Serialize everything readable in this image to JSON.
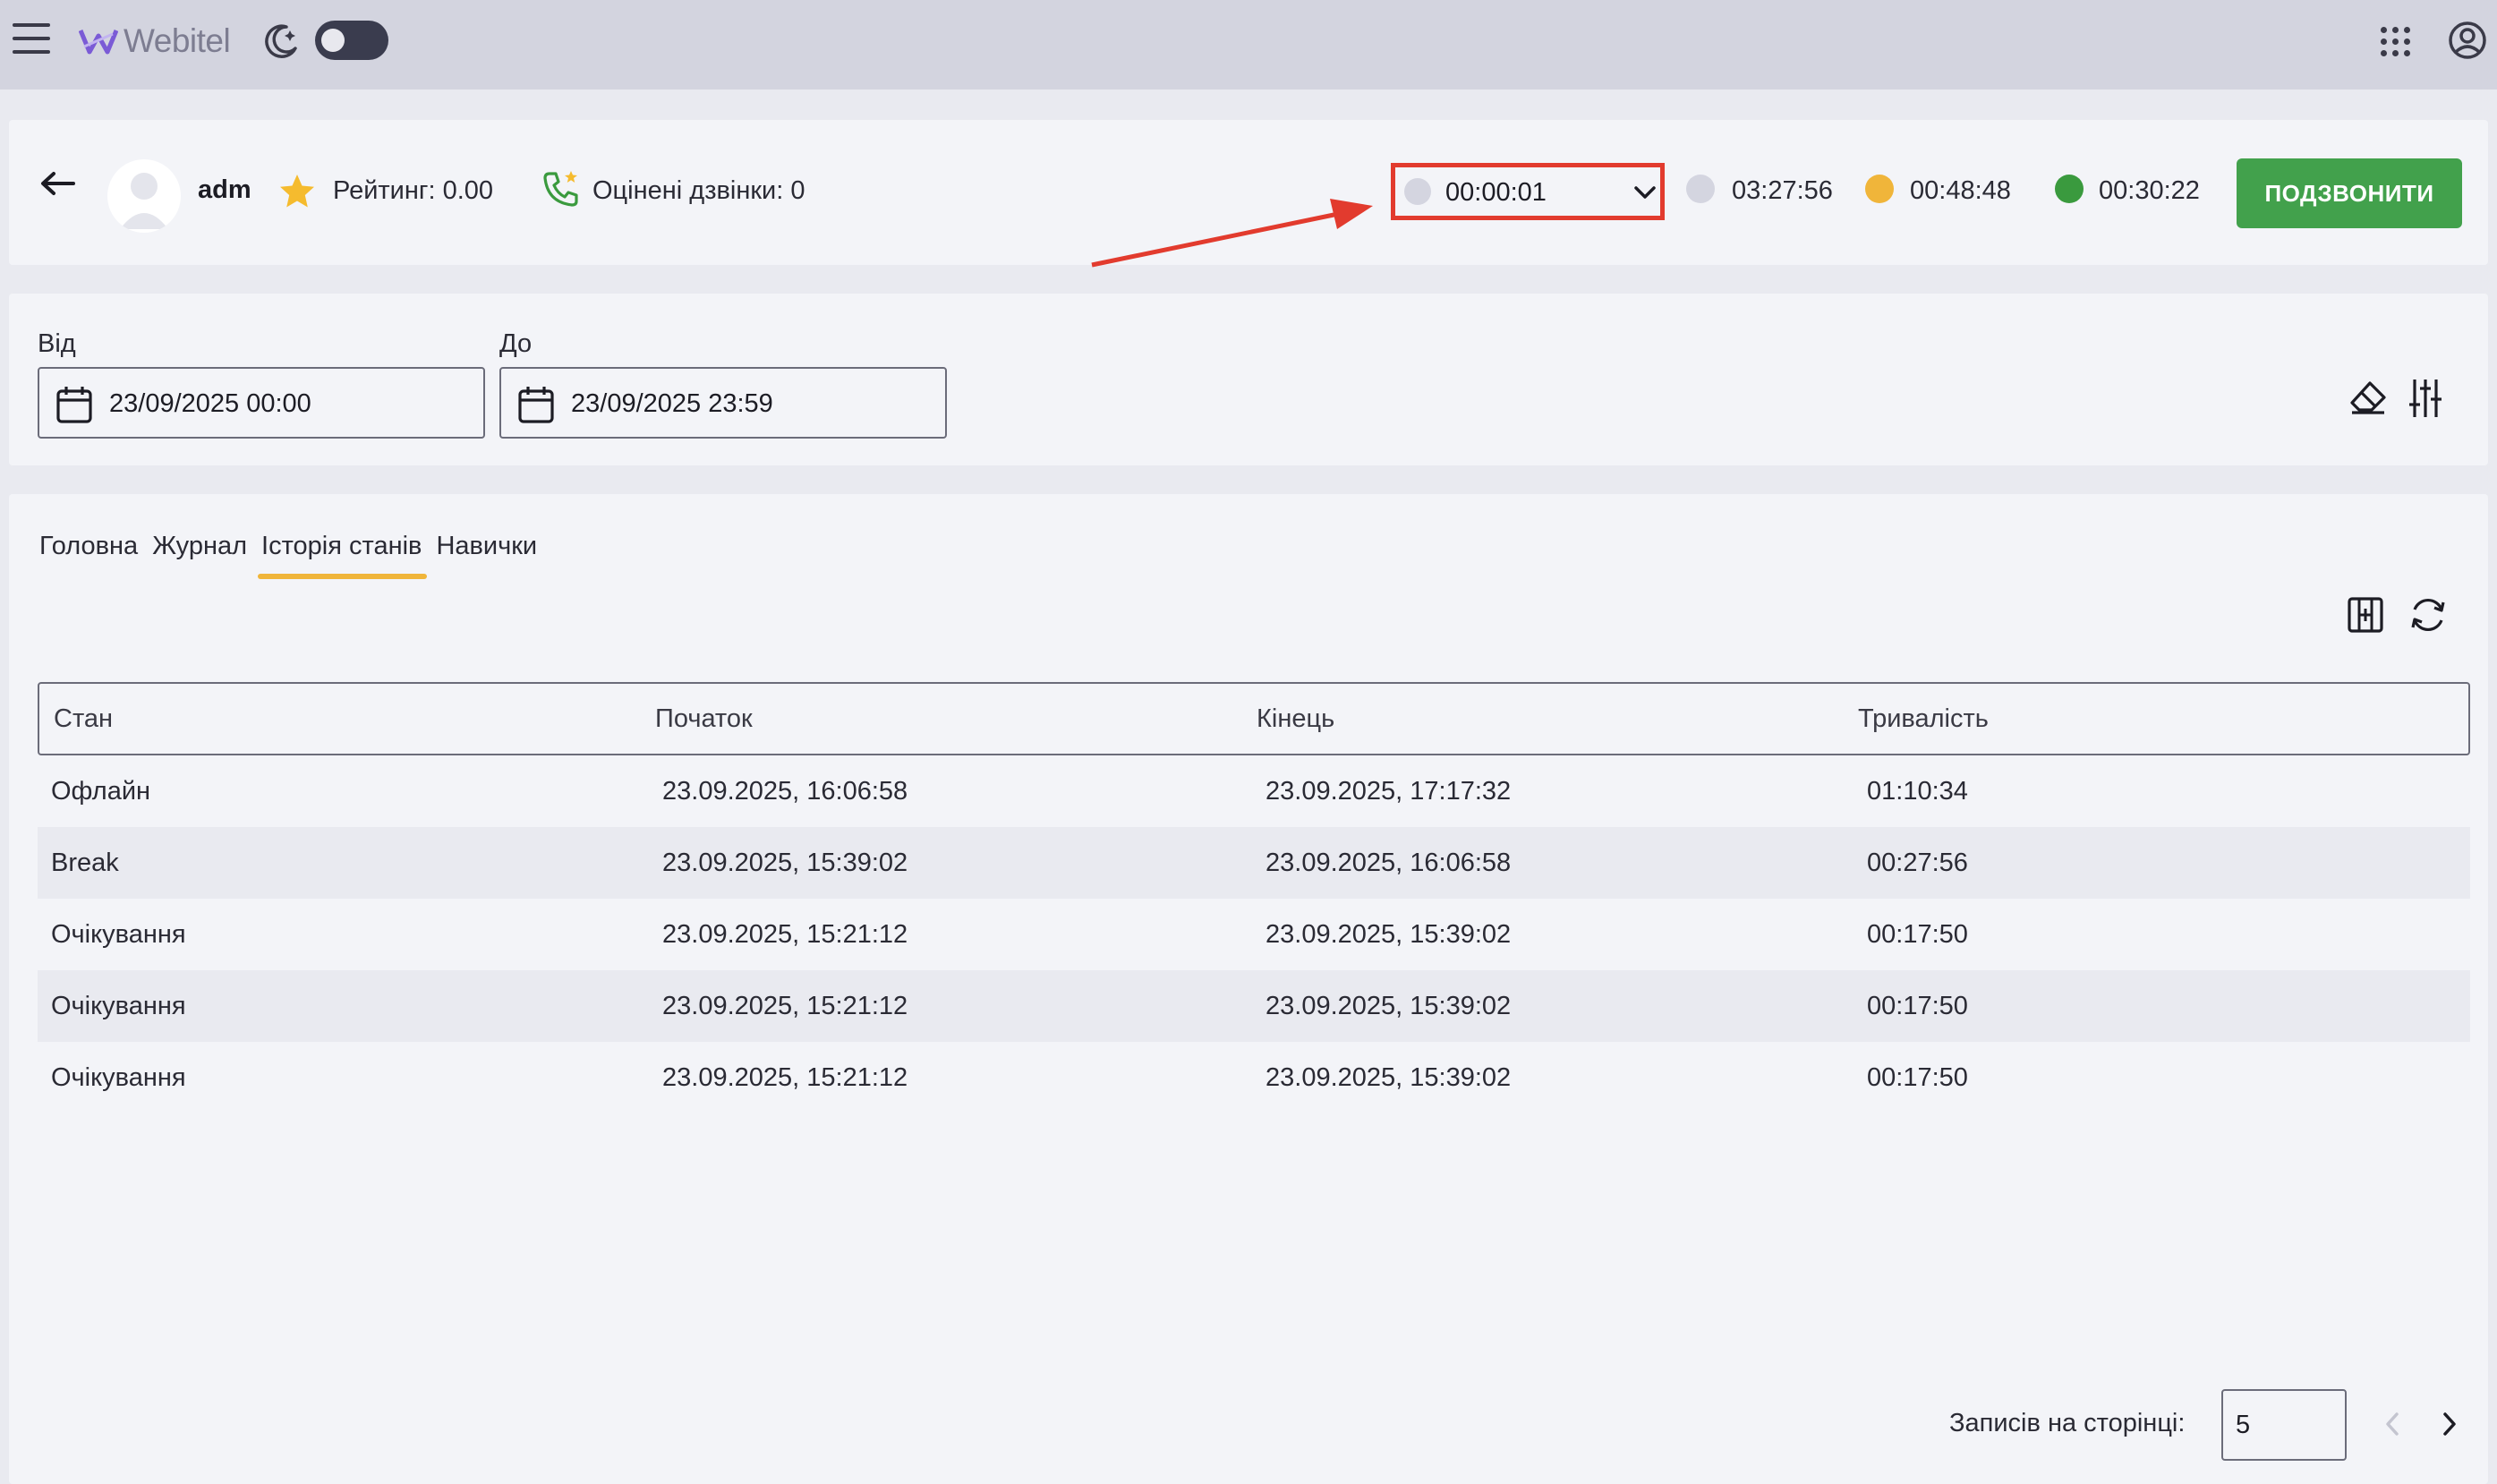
{
  "topbar": {
    "logo_text": "Webitel",
    "icons": [
      "menu-icon",
      "webitel-logo-icon",
      "moon-icon",
      "theme-toggle",
      "apps-grid-icon",
      "user-account-icon"
    ]
  },
  "agent": {
    "name": "adm",
    "rating": "Рейтинг: 0.00",
    "rated_calls": "Оцінені дзвінки: 0",
    "current_status_time": "00:00:01",
    "stats": [
      {
        "time": "03:27:56",
        "color": "#d4d5e0"
      },
      {
        "time": "00:48:48",
        "color": "#f0b53a"
      },
      {
        "time": "00:30:22",
        "color": "#3a9a3e"
      }
    ],
    "call_button": "ПОДЗВОНИТИ"
  },
  "filters": {
    "from_label": "Від",
    "from_value": "23/09/2025 00:00",
    "to_label": "До",
    "to_value": "23/09/2025 23:59"
  },
  "tabs": [
    {
      "label": "Головна",
      "active": false
    },
    {
      "label": "Журнал",
      "active": false
    },
    {
      "label": "Історія станів",
      "active": true
    },
    {
      "label": "Навички",
      "active": false
    }
  ],
  "table": {
    "headers": [
      "Стан",
      "Початок",
      "Кінець",
      "Тривалість"
    ],
    "rows": [
      [
        "Офлайн",
        "23.09.2025, 16:06:58",
        "23.09.2025, 17:17:32",
        "01:10:34"
      ],
      [
        "Break",
        "23.09.2025, 15:39:02",
        "23.09.2025, 16:06:58",
        "00:27:56"
      ],
      [
        "Очікування",
        "23.09.2025, 15:21:12",
        "23.09.2025, 15:39:02",
        "00:17:50"
      ],
      [
        "Очікування",
        "23.09.2025, 15:21:12",
        "23.09.2025, 15:39:02",
        "00:17:50"
      ],
      [
        "Очікування",
        "23.09.2025, 15:21:12",
        "23.09.2025, 15:39:02",
        "00:17:50"
      ]
    ]
  },
  "pagination": {
    "label": "Записів на сторінці:",
    "per_page": "5"
  },
  "colors": {
    "accent_green": "#42a14c",
    "tab_underline": "#f0b53a",
    "annotation_red": "#e23b2e"
  }
}
